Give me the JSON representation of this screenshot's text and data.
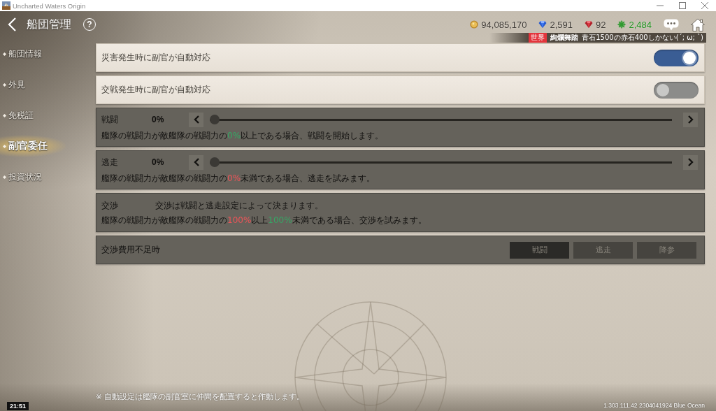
{
  "window": {
    "title": "Uncharted Waters Origin"
  },
  "header": {
    "title": "船団管理",
    "help": "?"
  },
  "currencies": [
    {
      "kind": "coin",
      "value": "94,085,170"
    },
    {
      "kind": "sapphire",
      "value": "2,591"
    },
    {
      "kind": "ruby",
      "value": "92"
    },
    {
      "kind": "wheel",
      "value": "2,484"
    }
  ],
  "chat_ticker": {
    "channel": "世界",
    "sender": "絢爛舞踏",
    "message": "青石1500の赤石400しかない(´; ω; `)"
  },
  "sidebar": {
    "items": [
      {
        "label": "船団情報",
        "selected": false
      },
      {
        "label": "外見",
        "selected": false
      },
      {
        "label": "免税証",
        "selected": false
      },
      {
        "label": "副官委任",
        "selected": true
      },
      {
        "label": "投資状況",
        "selected": false
      }
    ]
  },
  "settings": [
    {
      "kind": "toggle",
      "label": "災害発生時に副官が自動対応",
      "on": true
    },
    {
      "kind": "toggle",
      "label": "交戦発生時に副官が自動対応",
      "on": false
    },
    {
      "kind": "slider",
      "label": "戦闘",
      "reading": "0%",
      "level": 0,
      "description": [
        {
          "text": "艦隊の戦闘力が敵艦隊の戦闘力の"
        },
        {
          "text": "0%",
          "color": "#35a865"
        },
        {
          "text": "以上である場合、戦闘を開始します。"
        }
      ]
    },
    {
      "kind": "slider",
      "label": "逃走",
      "reading": "0%",
      "level": 0,
      "description": [
        {
          "text": "艦隊の戦闘力が敵艦隊の戦闘力の"
        },
        {
          "text": "0%",
          "color": "#f05458"
        },
        {
          "text": "未満である場合、逃走を試みます。"
        }
      ]
    },
    {
      "kind": "info",
      "label": "交渉",
      "info": "交渉は戦闘と逃走設定によって決まります。",
      "description": [
        {
          "text": "艦隊の戦闘力が敵艦隊の戦闘力の"
        },
        {
          "text": "100%",
          "color": "#f05458"
        },
        {
          "text": "以上"
        },
        {
          "text": "100%",
          "color": "#35a865"
        },
        {
          "text": "未満である場合、交渉を試みます。"
        }
      ]
    },
    {
      "kind": "choice",
      "label": "交渉費用不足時",
      "options": [
        {
          "label": "戦闘",
          "selected": true
        },
        {
          "label": "逃走",
          "selected": false
        },
        {
          "label": "降参",
          "selected": false
        }
      ]
    }
  ],
  "footer": {
    "note": "※ 自動設定は艦隊の副官室に仲間を配置すると作動します。",
    "version": "1.303.111.42 2304041924 Blue Ocean",
    "clock": "21:51"
  }
}
